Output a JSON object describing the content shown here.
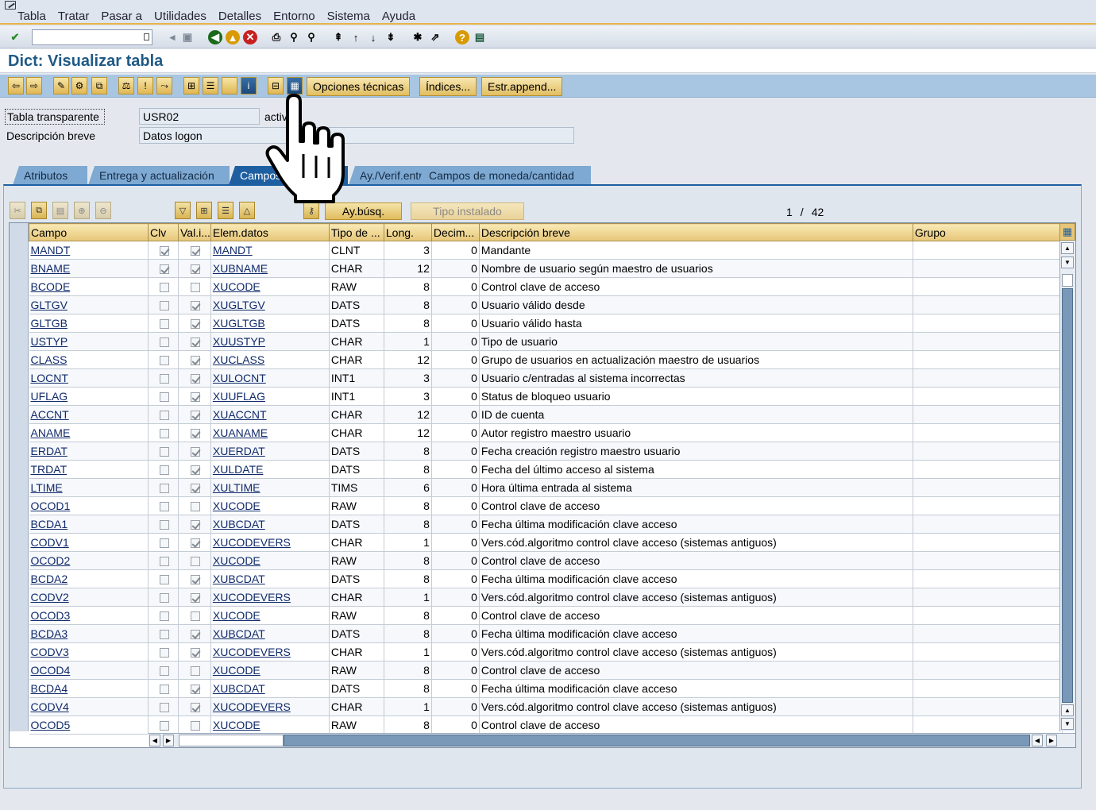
{
  "menu": [
    "Tabla",
    "Tratar",
    "Pasar a",
    "Utilidades",
    "Detalles",
    "Entorno",
    "Sistema",
    "Ayuda"
  ],
  "title": "Dict: Visualizar tabla",
  "app_toolbar": {
    "opciones_tecnicas": "Opciones técnicas",
    "indices": "Índices...",
    "estr_append": "Estr.append..."
  },
  "header": {
    "tabla_transparente_label": "Tabla transparente",
    "tabla_value": "USR02",
    "status": "activ",
    "descripcion_label": "Descripción breve",
    "descripcion_value": "Datos logon"
  },
  "tabs": [
    "Atributos",
    "Entrega y actualización",
    "Campos",
    "Ay./Verif.entr.",
    "Campos de moneda/cantidad"
  ],
  "active_tab": 2,
  "table_toolbar": {
    "aybusq": "Ay.búsq.",
    "tipo_instalado": "Tipo instalado",
    "page_current": "1",
    "page_sep": "/",
    "page_total": "42"
  },
  "columns": [
    "Campo",
    "Clv",
    "Val.i...",
    "Elem.datos",
    "Tipo de ...",
    "Long.",
    "Decim...",
    "Descripción breve",
    "Grupo"
  ],
  "rows": [
    {
      "campo": "MANDT",
      "clv": true,
      "val": true,
      "elem": "MANDT",
      "tipo": "CLNT",
      "long": "3",
      "dec": "0",
      "desc": "Mandante"
    },
    {
      "campo": "BNAME",
      "clv": true,
      "val": true,
      "elem": "XUBNAME",
      "tipo": "CHAR",
      "long": "12",
      "dec": "0",
      "desc": "Nombre de usuario según maestro de usuarios"
    },
    {
      "campo": "BCODE",
      "clv": false,
      "val": false,
      "elem": "XUCODE",
      "tipo": "RAW",
      "long": "8",
      "dec": "0",
      "desc": "Control clave de acceso"
    },
    {
      "campo": "GLTGV",
      "clv": false,
      "val": true,
      "elem": "XUGLTGV",
      "tipo": "DATS",
      "long": "8",
      "dec": "0",
      "desc": "Usuario válido desde"
    },
    {
      "campo": "GLTGB",
      "clv": false,
      "val": true,
      "elem": "XUGLTGB",
      "tipo": "DATS",
      "long": "8",
      "dec": "0",
      "desc": "Usuario válido hasta"
    },
    {
      "campo": "USTYP",
      "clv": false,
      "val": true,
      "elem": "XUUSTYP",
      "tipo": "CHAR",
      "long": "1",
      "dec": "0",
      "desc": "Tipo de usuario"
    },
    {
      "campo": "CLASS",
      "clv": false,
      "val": true,
      "elem": "XUCLASS",
      "tipo": "CHAR",
      "long": "12",
      "dec": "0",
      "desc": "Grupo de usuarios en actualización maestro de usuarios"
    },
    {
      "campo": "LOCNT",
      "clv": false,
      "val": true,
      "elem": "XULOCNT",
      "tipo": "INT1",
      "long": "3",
      "dec": "0",
      "desc": "Usuario c/entradas al sistema incorrectas"
    },
    {
      "campo": "UFLAG",
      "clv": false,
      "val": true,
      "elem": "XUUFLAG",
      "tipo": "INT1",
      "long": "3",
      "dec": "0",
      "desc": "Status de bloqueo usuario"
    },
    {
      "campo": "ACCNT",
      "clv": false,
      "val": true,
      "elem": "XUACCNT",
      "tipo": "CHAR",
      "long": "12",
      "dec": "0",
      "desc": "ID de cuenta"
    },
    {
      "campo": "ANAME",
      "clv": false,
      "val": true,
      "elem": "XUANAME",
      "tipo": "CHAR",
      "long": "12",
      "dec": "0",
      "desc": "Autor registro maestro usuario"
    },
    {
      "campo": "ERDAT",
      "clv": false,
      "val": true,
      "elem": "XUERDAT",
      "tipo": "DATS",
      "long": "8",
      "dec": "0",
      "desc": "Fecha creación registro maestro usuario"
    },
    {
      "campo": "TRDAT",
      "clv": false,
      "val": true,
      "elem": "XULDATE",
      "tipo": "DATS",
      "long": "8",
      "dec": "0",
      "desc": "Fecha del último acceso al sistema"
    },
    {
      "campo": "LTIME",
      "clv": false,
      "val": true,
      "elem": "XULTIME",
      "tipo": "TIMS",
      "long": "6",
      "dec": "0",
      "desc": "Hora última entrada al sistema"
    },
    {
      "campo": "OCOD1",
      "clv": false,
      "val": false,
      "elem": "XUCODE",
      "tipo": "RAW",
      "long": "8",
      "dec": "0",
      "desc": "Control clave de acceso"
    },
    {
      "campo": "BCDA1",
      "clv": false,
      "val": true,
      "elem": "XUBCDAT",
      "tipo": "DATS",
      "long": "8",
      "dec": "0",
      "desc": "Fecha última modificación clave acceso"
    },
    {
      "campo": "CODV1",
      "clv": false,
      "val": true,
      "elem": "XUCODEVERS",
      "tipo": "CHAR",
      "long": "1",
      "dec": "0",
      "desc": "Vers.cód.algoritmo control clave acceso (sistemas antiguos)"
    },
    {
      "campo": "OCOD2",
      "clv": false,
      "val": false,
      "elem": "XUCODE",
      "tipo": "RAW",
      "long": "8",
      "dec": "0",
      "desc": "Control clave de acceso"
    },
    {
      "campo": "BCDA2",
      "clv": false,
      "val": true,
      "elem": "XUBCDAT",
      "tipo": "DATS",
      "long": "8",
      "dec": "0",
      "desc": "Fecha última modificación clave acceso"
    },
    {
      "campo": "CODV2",
      "clv": false,
      "val": true,
      "elem": "XUCODEVERS",
      "tipo": "CHAR",
      "long": "1",
      "dec": "0",
      "desc": "Vers.cód.algoritmo control clave acceso (sistemas antiguos)"
    },
    {
      "campo": "OCOD3",
      "clv": false,
      "val": false,
      "elem": "XUCODE",
      "tipo": "RAW",
      "long": "8",
      "dec": "0",
      "desc": "Control clave de acceso"
    },
    {
      "campo": "BCDA3",
      "clv": false,
      "val": true,
      "elem": "XUBCDAT",
      "tipo": "DATS",
      "long": "8",
      "dec": "0",
      "desc": "Fecha última modificación clave acceso"
    },
    {
      "campo": "CODV3",
      "clv": false,
      "val": true,
      "elem": "XUCODEVERS",
      "tipo": "CHAR",
      "long": "1",
      "dec": "0",
      "desc": "Vers.cód.algoritmo control clave acceso (sistemas antiguos)"
    },
    {
      "campo": "OCOD4",
      "clv": false,
      "val": false,
      "elem": "XUCODE",
      "tipo": "RAW",
      "long": "8",
      "dec": "0",
      "desc": "Control clave de acceso"
    },
    {
      "campo": "BCDA4",
      "clv": false,
      "val": true,
      "elem": "XUBCDAT",
      "tipo": "DATS",
      "long": "8",
      "dec": "0",
      "desc": "Fecha última modificación clave acceso"
    },
    {
      "campo": "CODV4",
      "clv": false,
      "val": true,
      "elem": "XUCODEVERS",
      "tipo": "CHAR",
      "long": "1",
      "dec": "0",
      "desc": "Vers.cód.algoritmo control clave acceso (sistemas antiguos)"
    },
    {
      "campo": "OCOD5",
      "clv": false,
      "val": false,
      "elem": "XUCODE",
      "tipo": "RAW",
      "long": "8",
      "dec": "0",
      "desc": "Control clave de acceso"
    }
  ],
  "colors": {
    "tab_active": "#1e5fa1",
    "tab_inactive": "#7ea9d2",
    "header_gold": "#e7c678",
    "app_toolbar": "#a8c6e2"
  }
}
